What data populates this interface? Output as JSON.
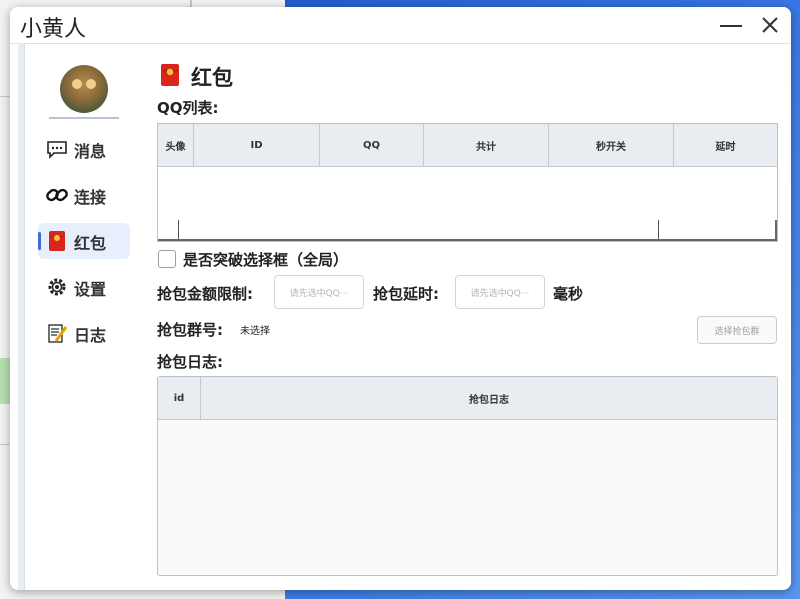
{
  "window": {
    "title": "小黄人"
  },
  "sidebar": {
    "items": [
      {
        "label": "消息",
        "icon": "message-icon",
        "active": false
      },
      {
        "label": "连接",
        "icon": "link-icon",
        "active": false
      },
      {
        "label": "红包",
        "icon": "red-envelope-icon",
        "active": true
      },
      {
        "label": "设置",
        "icon": "gear-icon",
        "active": false
      },
      {
        "label": "日志",
        "icon": "log-icon",
        "active": false
      }
    ]
  },
  "page": {
    "title": "红包",
    "qq_list_label": "QQ列表:",
    "qq_table": {
      "columns": [
        "头像",
        "ID",
        "QQ",
        "共计",
        "秒开关",
        "延时"
      ],
      "rows": []
    },
    "checkbox_label": "是否突破选择框（全局）",
    "amount_limit_label": "抢包金额限制:",
    "amount_placeholder": "请先选中QQ···",
    "delay_label": "抢包延时:",
    "delay_placeholder": "请先选中QQ···",
    "ms_label": "毫秒",
    "group_label": "抢包群号:",
    "group_value": "未选择",
    "select_group_button": "选择抢包群",
    "log_label": "抢包日志:",
    "log_table": {
      "columns": [
        "id",
        "抢包日志"
      ],
      "rows": []
    }
  },
  "colors": {
    "accent": "#3b6fd8",
    "active_bg": "#e7eefc"
  }
}
